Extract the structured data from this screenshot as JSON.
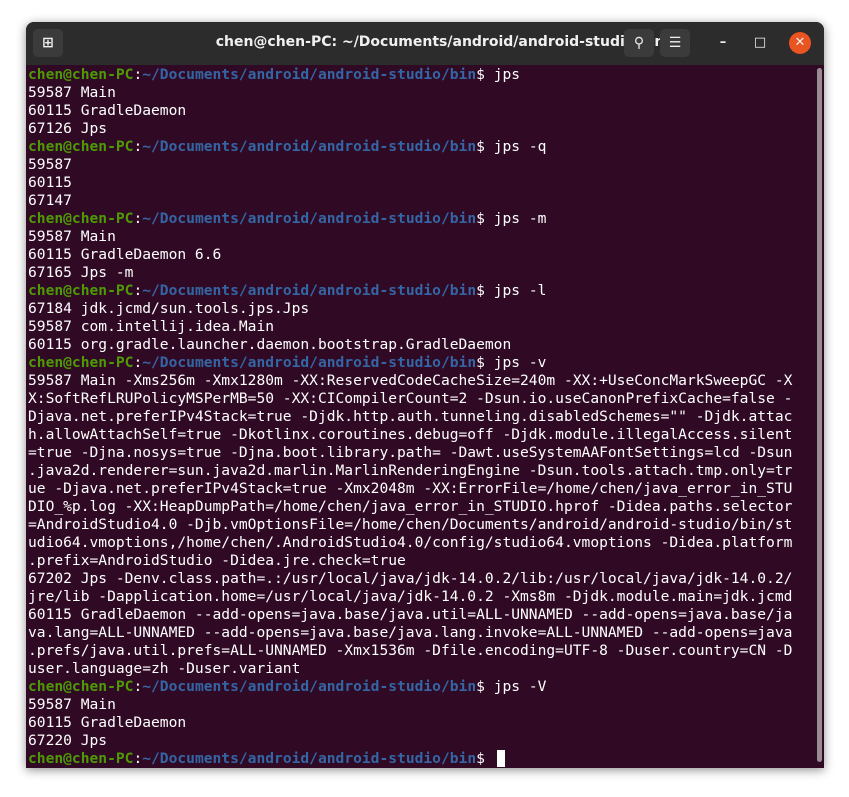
{
  "window": {
    "title": "chen@chen-PC: ~/Documents/android/android-studio/bin",
    "buttons": {
      "new_tab": "⊞",
      "search": "⚲",
      "menu": "☰",
      "minimize": "–",
      "maximize": "□",
      "close": "✕"
    }
  },
  "prompt": {
    "user": "chen@chen-PC",
    "colon": ":",
    "path": "~/Documents/android/android-studio/bin",
    "symbol": "$ "
  },
  "colors": {
    "background": "#300a24",
    "prompt_user": "#4e9a06",
    "prompt_path": "#3465a4",
    "close_button": "#e95420"
  },
  "terminal": {
    "lines": [
      {
        "prompt": true,
        "cmd": "jps"
      },
      {
        "text": "59587 Main"
      },
      {
        "text": "60115 GradleDaemon"
      },
      {
        "text": "67126 Jps"
      },
      {
        "prompt": true,
        "cmd": "jps -q"
      },
      {
        "text": "59587"
      },
      {
        "text": "60115"
      },
      {
        "text": "67147"
      },
      {
        "prompt": true,
        "cmd": "jps -m"
      },
      {
        "text": "59587 Main"
      },
      {
        "text": "60115 GradleDaemon 6.6"
      },
      {
        "text": "67165 Jps -m"
      },
      {
        "prompt": true,
        "cmd": "jps -l"
      },
      {
        "text": "67184 jdk.jcmd/sun.tools.jps.Jps"
      },
      {
        "text": "59587 com.intellij.idea.Main"
      },
      {
        "text": "60115 org.gradle.launcher.daemon.bootstrap.GradleDaemon"
      },
      {
        "prompt": true,
        "cmd": "jps -v"
      },
      {
        "text": "59587 Main -Xms256m -Xmx1280m -XX:ReservedCodeCacheSize=240m -XX:+UseConcMarkSweepGC -X"
      },
      {
        "text": "X:SoftRefLRUPolicyMSPerMB=50 -XX:CICompilerCount=2 -Dsun.io.useCanonPrefixCache=false -"
      },
      {
        "text": "Djava.net.preferIPv4Stack=true -Djdk.http.auth.tunneling.disabledSchemes=\"\" -Djdk.attac"
      },
      {
        "text": "h.allowAttachSelf=true -Dkotlinx.coroutines.debug=off -Djdk.module.illegalAccess.silent"
      },
      {
        "text": "=true -Djna.nosys=true -Djna.boot.library.path= -Dawt.useSystemAAFontSettings=lcd -Dsun"
      },
      {
        "text": ".java2d.renderer=sun.java2d.marlin.MarlinRenderingEngine -Dsun.tools.attach.tmp.only=tr"
      },
      {
        "text": "ue -Djava.net.preferIPv4Stack=true -Xmx2048m -XX:ErrorFile=/home/chen/java_error_in_STU"
      },
      {
        "text": "DIO_%p.log -XX:HeapDumpPath=/home/chen/java_error_in_STUDIO.hprof -Didea.paths.selector"
      },
      {
        "text": "=AndroidStudio4.0 -Djb.vmOptionsFile=/home/chen/Documents/android/android-studio/bin/st"
      },
      {
        "text": "udio64.vmoptions,/home/chen/.AndroidStudio4.0/config/studio64.vmoptions -Didea.platform"
      },
      {
        "text": ".prefix=AndroidStudio -Didea.jre.check=true"
      },
      {
        "text": "67202 Jps -Denv.class.path=.:/usr/local/java/jdk-14.0.2/lib:/usr/local/java/jdk-14.0.2/"
      },
      {
        "text": "jre/lib -Dapplication.home=/usr/local/java/jdk-14.0.2 -Xms8m -Djdk.module.main=jdk.jcmd"
      },
      {
        "text": "60115 GradleDaemon --add-opens=java.base/java.util=ALL-UNNAMED --add-opens=java.base/ja"
      },
      {
        "text": "va.lang=ALL-UNNAMED --add-opens=java.base/java.lang.invoke=ALL-UNNAMED --add-opens=java"
      },
      {
        "text": ".prefs/java.util.prefs=ALL-UNNAMED -Xmx1536m -Dfile.encoding=UTF-8 -Duser.country=CN -D"
      },
      {
        "text": "user.language=zh -Duser.variant"
      },
      {
        "prompt": true,
        "cmd": "jps -V"
      },
      {
        "text": "59587 Main"
      },
      {
        "text": "60115 GradleDaemon"
      },
      {
        "text": "67220 Jps"
      },
      {
        "prompt": true,
        "cmd": "",
        "cursor": true
      }
    ]
  }
}
